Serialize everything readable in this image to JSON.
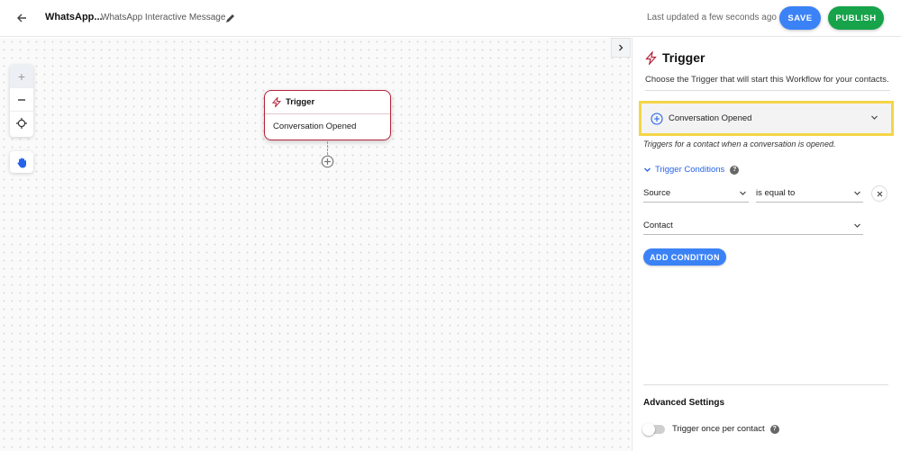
{
  "header": {
    "workflow_name": "WhatsApp...",
    "workflow_description": "WhatsApp Interactive Message",
    "last_updated": "Last updated a few seconds ago",
    "save_label": "SAVE",
    "publish_label": "PUBLISH"
  },
  "canvas": {
    "zoom_in_symbol": "+",
    "node": {
      "title": "Trigger",
      "event": "Conversation Opened"
    }
  },
  "panel": {
    "title": "Trigger",
    "description": "Choose the Trigger that will start this Workflow for your contacts.",
    "trigger_select_value": "Conversation Opened",
    "trigger_help": "Triggers for a contact when a conversation is opened.",
    "conditions_label": "Trigger Conditions",
    "condition": {
      "field": "Source",
      "operator": "is equal to",
      "value": "Contact"
    },
    "add_condition_label": "ADD CONDITION",
    "advanced_title": "Advanced Settings",
    "trigger_once_label": "Trigger once per contact",
    "trigger_once_enabled": false
  },
  "colors": {
    "primary": "#3b82f6",
    "publish": "#16a34a",
    "node_border": "#b4233c",
    "highlight": "#f5d547"
  },
  "icons": [
    "back-arrow-icon",
    "pencil-icon",
    "plus-icon",
    "minus-icon",
    "crosshair-icon",
    "hand-icon",
    "chevron-right-icon",
    "bolt-icon",
    "plus-circle-icon",
    "chevron-down-icon",
    "help-icon",
    "close-icon"
  ]
}
